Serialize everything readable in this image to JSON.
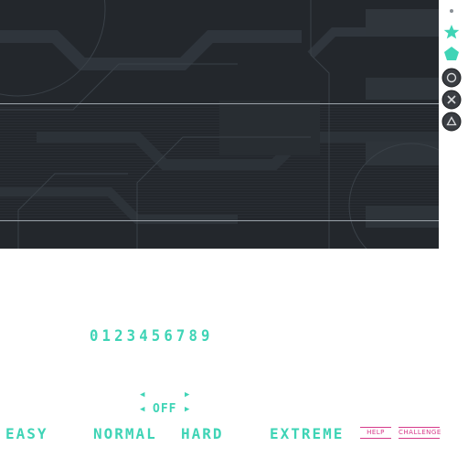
{
  "digits": "0123456789",
  "option": {
    "value": "OFF"
  },
  "difficulties": [
    "EASY",
    "NORMAL",
    "HARD",
    "EXTREME"
  ],
  "buttons": {
    "help": "HELP",
    "challenge": "CHALLENGE"
  },
  "icons": [
    "dot-icon",
    "star-icon",
    "pentagon-icon",
    "circle-button-icon",
    "cross-button-icon",
    "triangle-button-icon"
  ],
  "colors": {
    "accent": "#3fd4b6",
    "pink": "#d63a8a",
    "panel": "#24282d"
  }
}
